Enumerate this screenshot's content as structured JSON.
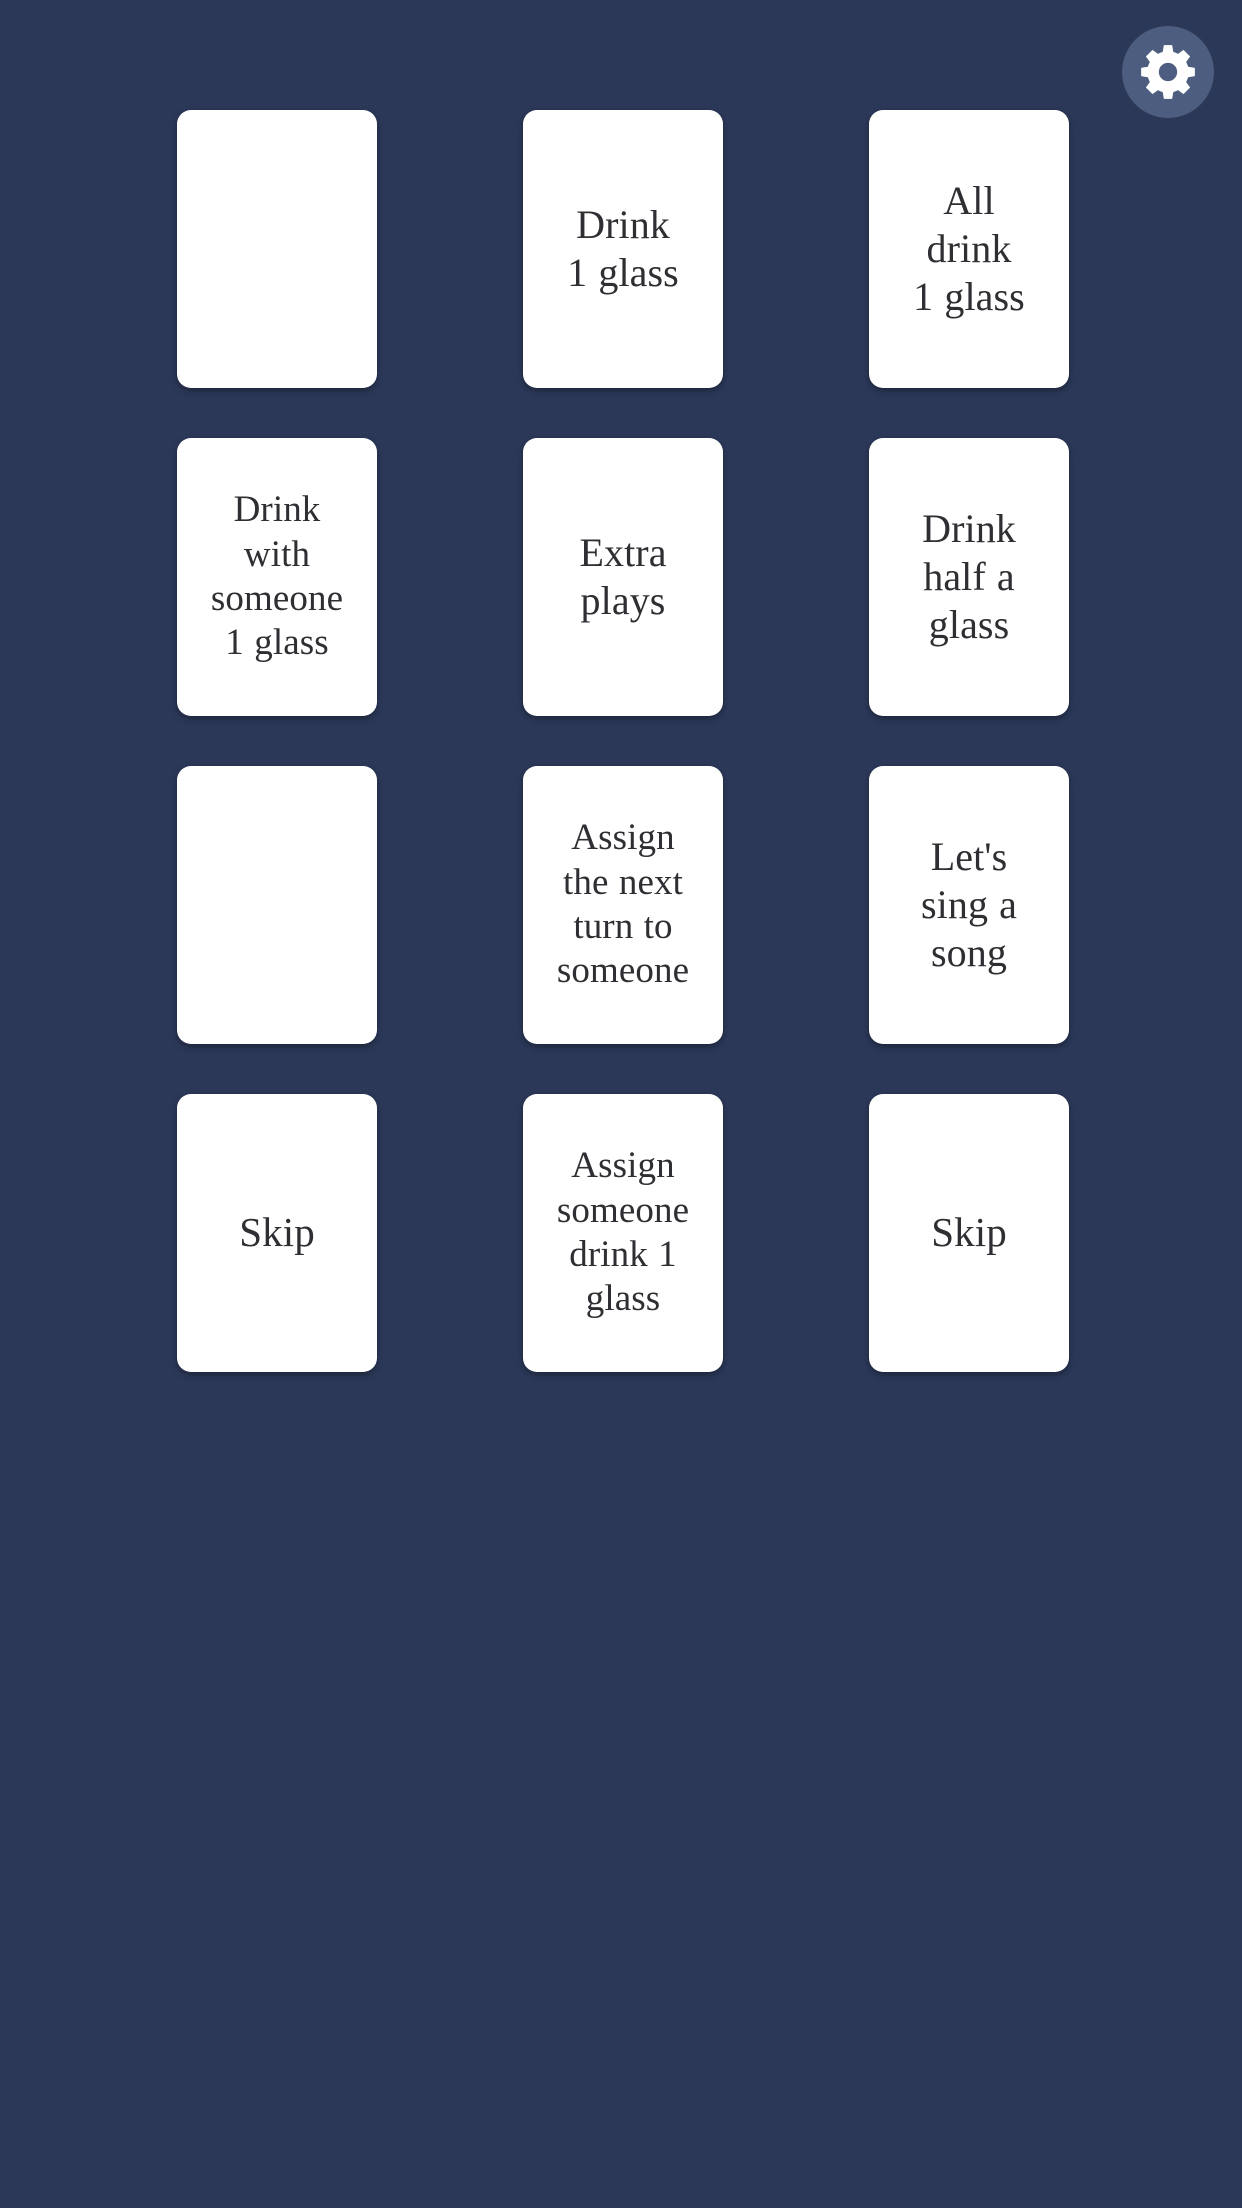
{
  "app": {
    "background_color": "#2b3858",
    "card_color": "#ffffff",
    "card_text_color": "#2e2e33",
    "accent_color": "#4c5d80"
  },
  "header": {
    "settings_button_label": "Settings",
    "settings_icon": "gear-icon"
  },
  "board": {
    "columns": 3,
    "rows": 4,
    "cards": [
      {
        "id": "card-1",
        "text": "",
        "row": 1,
        "col": 1,
        "face": "blank"
      },
      {
        "id": "card-2",
        "text": "Drink\n1 glass",
        "row": 1,
        "col": 2,
        "face": "up"
      },
      {
        "id": "card-3",
        "text": "All\ndrink\n1 glass",
        "row": 1,
        "col": 3,
        "face": "up"
      },
      {
        "id": "card-4",
        "text": "Drink\nwith\nsomeone\n1 glass",
        "row": 2,
        "col": 1,
        "face": "up"
      },
      {
        "id": "card-5",
        "text": "Extra\nplays",
        "row": 2,
        "col": 2,
        "face": "up"
      },
      {
        "id": "card-6",
        "text": "Drink\nhalf a\nglass",
        "row": 2,
        "col": 3,
        "face": "up"
      },
      {
        "id": "card-7",
        "text": "",
        "row": 3,
        "col": 1,
        "face": "blank"
      },
      {
        "id": "card-8",
        "text": "Assign\nthe next\nturn  to\nsomeone",
        "row": 3,
        "col": 2,
        "face": "up"
      },
      {
        "id": "card-9",
        "text": "Let's\nsing  a\nsong",
        "row": 3,
        "col": 3,
        "face": "up"
      },
      {
        "id": "card-10",
        "text": "Skip",
        "row": 4,
        "col": 1,
        "face": "up"
      },
      {
        "id": "card-11",
        "text": "Assign\nsomeone\ndrink 1\nglass",
        "row": 4,
        "col": 2,
        "face": "up"
      },
      {
        "id": "card-12",
        "text": "Skip",
        "row": 4,
        "col": 3,
        "face": "up"
      }
    ]
  }
}
